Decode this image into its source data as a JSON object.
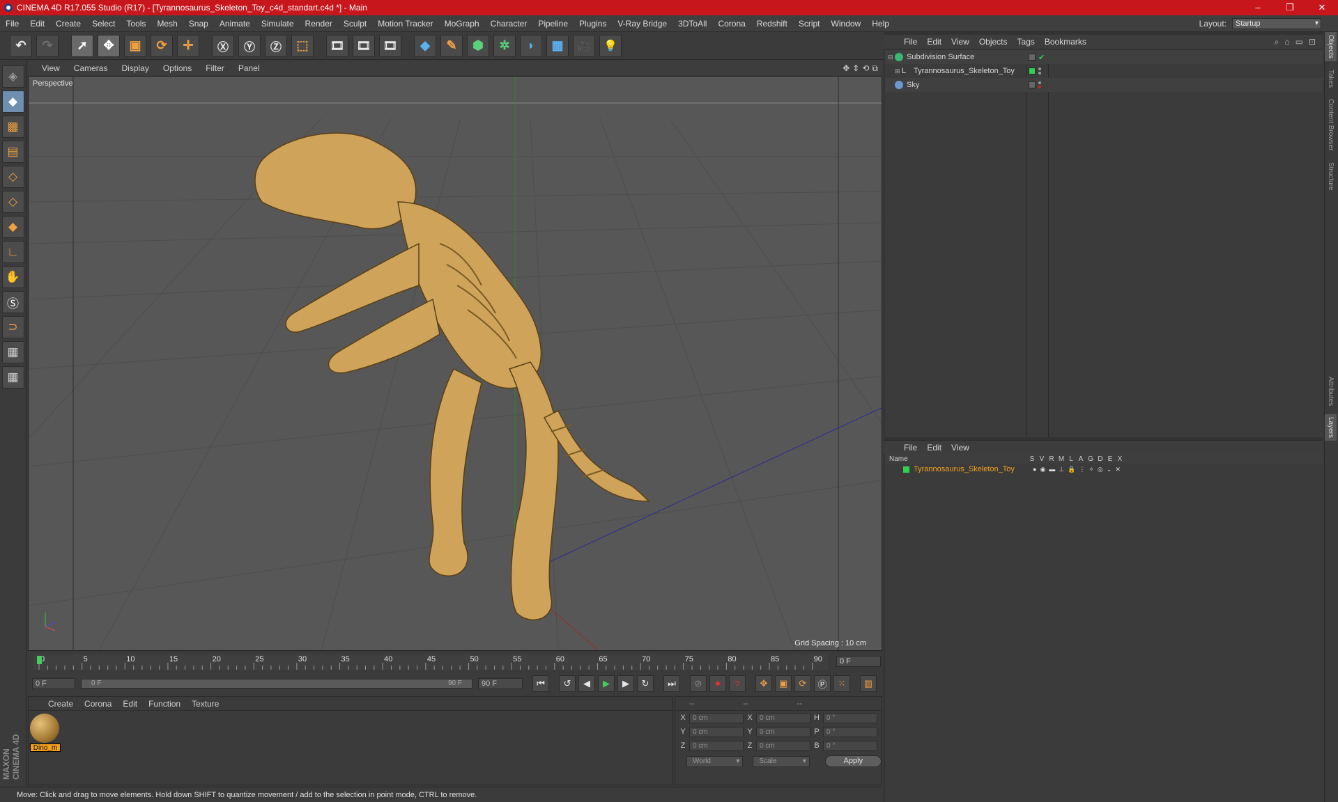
{
  "window": {
    "title": "CINEMA 4D R17.055 Studio (R17) - [Tyrannosaurus_Skeleton_Toy_c4d_standart.c4d *] - Main"
  },
  "menubar": {
    "items": [
      "File",
      "Edit",
      "Create",
      "Select",
      "Tools",
      "Mesh",
      "Snap",
      "Animate",
      "Simulate",
      "Render",
      "Sculpt",
      "Motion Tracker",
      "MoGraph",
      "Character",
      "Pipeline",
      "Plugins",
      "V-Ray Bridge",
      "3DToAll",
      "Corona",
      "Redshift",
      "Script",
      "Window",
      "Help"
    ],
    "layout_label": "Layout:",
    "layout_value": "Startup"
  },
  "viewport": {
    "menu": [
      "View",
      "Cameras",
      "Display",
      "Options",
      "Filter",
      "Panel"
    ],
    "label": "Perspective",
    "grid_spacing": "Grid Spacing : 10 cm"
  },
  "timeline": {
    "ticks": [
      "0",
      "5",
      "10",
      "15",
      "20",
      "25",
      "30",
      "35",
      "40",
      "45",
      "50",
      "55",
      "60",
      "65",
      "70",
      "75",
      "80",
      "85",
      "90"
    ],
    "current_frame": "0 F",
    "start_field": "0 F",
    "range_start": "0 F",
    "range_end": "90 F",
    "end_field": "90 F"
  },
  "material_panel": {
    "menu": [
      "Create",
      "Corona",
      "Edit",
      "Function",
      "Texture"
    ],
    "material_name": "Dino_m"
  },
  "coords_panel": {
    "headers": [
      "--",
      "--",
      "--"
    ],
    "rows": [
      {
        "a": "X",
        "av": "0 cm",
        "b": "X",
        "bv": "0 cm",
        "c": "H",
        "cv": "0 °"
      },
      {
        "a": "Y",
        "av": "0 cm",
        "b": "Y",
        "bv": "0 cm",
        "c": "P",
        "cv": "0 °"
      },
      {
        "a": "Z",
        "av": "0 cm",
        "b": "Z",
        "bv": "0 cm",
        "c": "B",
        "cv": "0 °"
      }
    ],
    "space": "World",
    "mode": "Scale",
    "apply": "Apply"
  },
  "status": {
    "text": "Move: Click and drag to move elements. Hold down SHIFT to quantize movement / add to the selection in point mode, CTRL to remove."
  },
  "object_manager": {
    "menu": [
      "File",
      "Edit",
      "View",
      "Objects",
      "Tags",
      "Bookmarks"
    ],
    "objects": [
      {
        "name": "Subdivision Surface"
      },
      {
        "name": "Tyrannosaurus_Skeleton_Toy"
      },
      {
        "name": "Sky"
      }
    ]
  },
  "layer_manager": {
    "menu": [
      "File",
      "Edit",
      "View"
    ],
    "header_name": "Name",
    "flags": [
      "S",
      "V",
      "R",
      "M",
      "L",
      "A",
      "G",
      "D",
      "E",
      "X"
    ],
    "layers": [
      {
        "name": "Tyrannosaurus_Skeleton_Toy"
      }
    ]
  },
  "side_tabs": [
    "Objects",
    "Takes",
    "Content Browser",
    "Structure",
    "Attributes",
    "Layers"
  ],
  "brand": {
    "text": "MAXON CINEMA 4D"
  },
  "colors": {
    "title_bar": "#c8161d",
    "accent": "#f0a020",
    "model": "#cfa45a"
  }
}
